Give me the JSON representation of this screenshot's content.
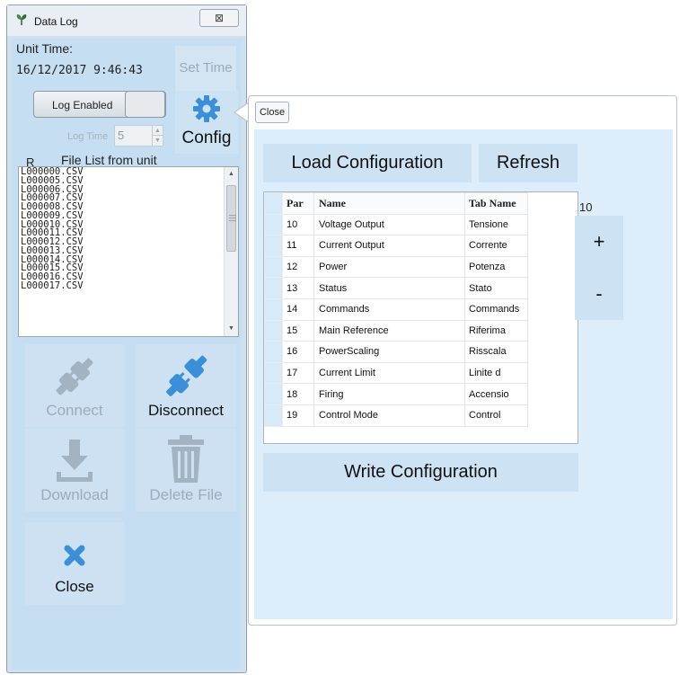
{
  "window": {
    "title": "Data Log",
    "close_glyph": "⊠"
  },
  "unit": {
    "label": "Unit Time:",
    "time": "16/12/2017  9:46:43"
  },
  "buttons": {
    "set_time": "Set Time",
    "log_enabled": "Log Enabled",
    "config": "Config",
    "connect": "Connect",
    "disconnect": "Disconnect",
    "download": "Download",
    "delete_file": "Delete File",
    "close": "Close"
  },
  "log_time": {
    "label": "Log Time",
    "value": "5"
  },
  "file_list": {
    "r_label": "R",
    "header": "File List from unit",
    "files": [
      "L000000.CSV",
      "L000005.CSV",
      "L000006.CSV",
      "L000007.CSV",
      "L000008.CSV",
      "L000009.CSV",
      "L000010.CSV",
      "L000011.CSV",
      "L000012.CSV",
      "L000013.CSV",
      "L000014.CSV",
      "L000015.CSV",
      "L000016.CSV",
      "L000017.CSV"
    ]
  },
  "config_popup": {
    "close": "Close",
    "load_configuration": "Load Configuration",
    "refresh": "Refresh",
    "write_configuration": "Write Configuration",
    "count": "10",
    "plus": "+",
    "minus": "-",
    "columns": [
      "Par",
      "Name",
      "Tab Name"
    ],
    "rows": [
      {
        "par": "10",
        "name": "Voltage Output",
        "tab": "Tensione"
      },
      {
        "par": "11",
        "name": "Current Output",
        "tab": "Corrente"
      },
      {
        "par": "12",
        "name": "Power",
        "tab": "Potenza"
      },
      {
        "par": "13",
        "name": "Status",
        "tab": "Stato"
      },
      {
        "par": "14",
        "name": "Commands",
        "tab": "Commands"
      },
      {
        "par": "15",
        "name": "Main Reference",
        "tab": "Riferima"
      },
      {
        "par": "16",
        "name": "PowerScaling",
        "tab": "Risscala"
      },
      {
        "par": "17",
        "name": "Current Limit",
        "tab": "Linite d"
      },
      {
        "par": "18",
        "name": "Firing",
        "tab": "Accensio"
      },
      {
        "par": "19",
        "name": "Control Mode",
        "tab": "Control"
      }
    ]
  },
  "colors": {
    "panel_bg": "#c6def2",
    "button_bg": "#cde2f3",
    "disabled_text": "#9dacba",
    "accent_blue": "#3a8fd8"
  },
  "icons": {
    "app": "plant-icon",
    "config": "gear-icon",
    "connect": "plug-connect-icon",
    "disconnect": "plug-disconnect-icon",
    "download": "download-icon",
    "delete": "trash-icon",
    "close": "x-icon"
  }
}
